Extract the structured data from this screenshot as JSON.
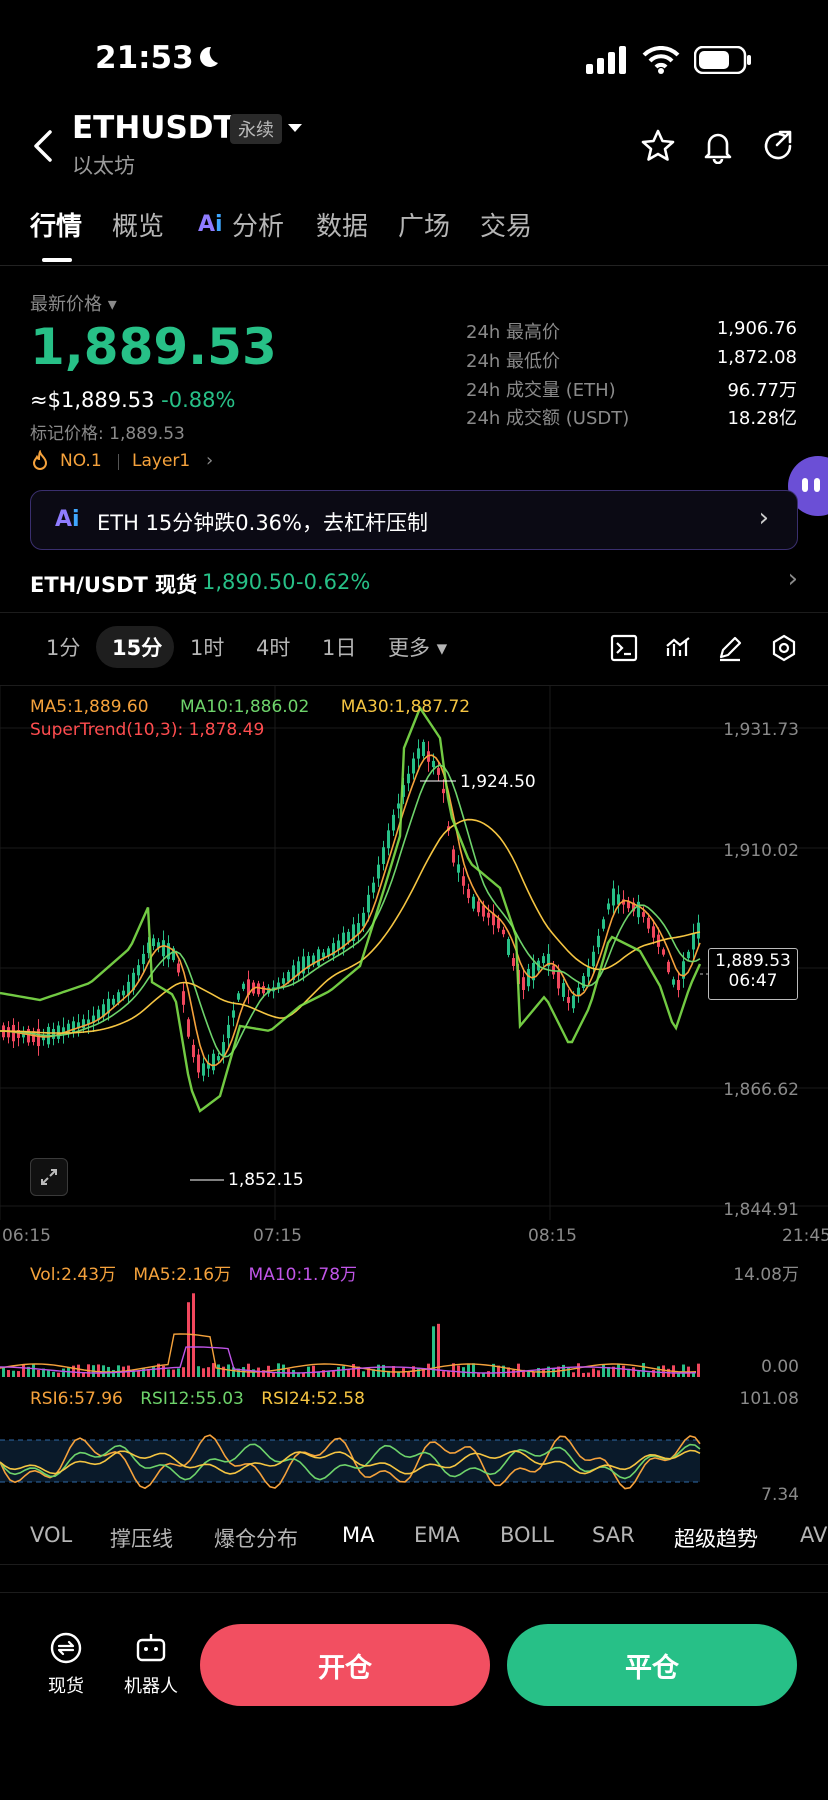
{
  "status_bar": {
    "time": "21:53"
  },
  "header": {
    "symbol": "ETHUSDT",
    "contract_type": "永续",
    "subtitle": "以太坊"
  },
  "tabs": [
    "行情",
    "概览",
    "分析",
    "数据",
    "广场",
    "交易"
  ],
  "price": {
    "label": "最新价格",
    "last": "1,889.53",
    "approx_usd": "≈$1,889.53",
    "change": "-0.88%",
    "mark_label": "标记价格:",
    "mark_value": "1,889.53",
    "rank": "NO.1",
    "sector": "Layer1"
  },
  "stats": [
    {
      "label": "24h 最高价",
      "value": "1,906.76"
    },
    {
      "label": "24h 最低价",
      "value": "1,872.08"
    },
    {
      "label": "24h 成交量 (ETH)",
      "value": "96.77万"
    },
    {
      "label": "24h 成交额 (USDT)",
      "value": "18.28亿"
    }
  ],
  "ai_banner": {
    "badge": "AI",
    "text": "ETH 15分钟跌0.36%，去杠杆压制"
  },
  "spot": {
    "pair": "ETH/USDT 现货",
    "price": "1,890.50",
    "change": "-0.62%"
  },
  "timeframes": [
    "1分",
    "15分",
    "1时",
    "4时",
    "1日",
    "更多"
  ],
  "active_timeframe": "15分",
  "chart_info": {
    "ma5": "MA5:1,889.60",
    "ma10": "MA10:1,886.02",
    "ma30": "MA30:1,887.72",
    "supertrend": "SuperTrend(10,3): 1,878.49",
    "y_ticks": [
      "1,931.73",
      "1,910.02",
      "1,866.62",
      "1,844.91"
    ],
    "x_ticks": [
      "06:15",
      "07:15",
      "08:15",
      "21:45"
    ],
    "high_marker": "1,924.50",
    "low_marker": "1,852.15",
    "current_price": "1,889.53",
    "countdown": "06:47"
  },
  "volume_info": {
    "vol": "Vol:2.43万",
    "ma5": "MA5:2.16万",
    "ma10": "MA10:1.78万",
    "max": "14.08万",
    "min": "0.00"
  },
  "rsi_info": {
    "rsi6": "RSI6:57.96",
    "rsi12": "RSI12:55.03",
    "rsi24": "RSI24:52.58",
    "max": "101.08",
    "min": "7.34"
  },
  "indicator_tabs": [
    "VOL",
    "撑压线",
    "爆仓分布",
    "MA",
    "EMA",
    "BOLL",
    "SAR",
    "超级趋势",
    "AV"
  ],
  "bottom_bar": {
    "spot_label": "现货",
    "bot_label": "机器人",
    "open_label": "开仓",
    "close_label": "平仓"
  },
  "colors": {
    "up": "#27c087",
    "down": "#f0475d",
    "ma5": "#f5a23c",
    "ma10": "#6ed36b",
    "ma30": "#f5c542",
    "supertrend": "#ff4d4f",
    "accent_ai": "#7b61ff"
  }
}
